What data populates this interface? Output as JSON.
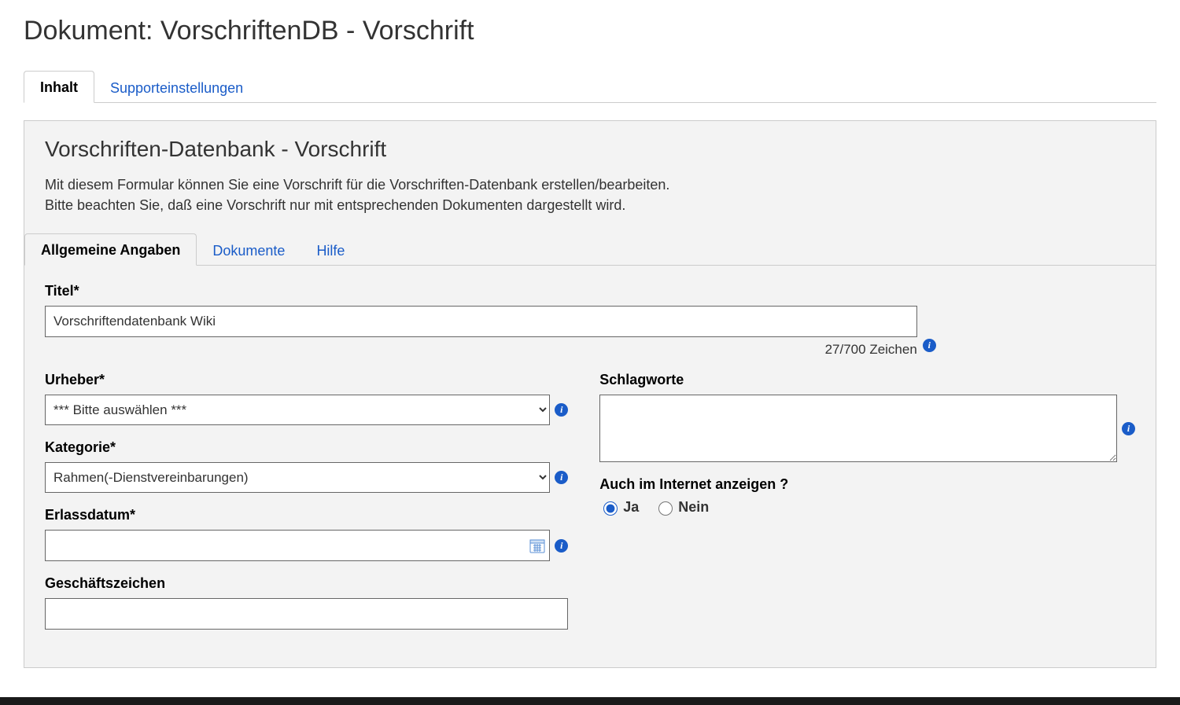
{
  "header": {
    "title": "Dokument: VorschriftenDB - Vorschrift"
  },
  "tabs": {
    "inhalt": "Inhalt",
    "support": "Supporteinstellungen"
  },
  "panel": {
    "title": "Vorschriften-Datenbank - Vorschrift",
    "desc_line1": "Mit diesem Formular können Sie eine Vorschrift für die Vorschriften-Datenbank erstellen/bearbeiten.",
    "desc_line2": "Bitte beachten Sie, daß eine Vorschrift nur mit entsprechenden Dokumenten dargestellt wird."
  },
  "inner_tabs": {
    "allgemein": "Allgemeine Angaben",
    "dokumente": "Dokumente",
    "hilfe": "Hilfe"
  },
  "form": {
    "titel_label": "Titel*",
    "titel_value": "Vorschriftendatenbank Wiki",
    "titel_counter": "27/700 Zeichen",
    "urheber_label": "Urheber*",
    "urheber_value": "*** Bitte auswählen ***",
    "kategorie_label": "Kategorie*",
    "kategorie_value": "Rahmen(-Dienstvereinbarungen)",
    "erlassdatum_label": "Erlassdatum*",
    "erlassdatum_value": "",
    "geschaeftszeichen_label": "Geschäftszeichen",
    "geschaeftszeichen_value": "",
    "schlagworte_label": "Schlagworte",
    "schlagworte_value": "",
    "internet_label": "Auch im Internet anzeigen ?",
    "internet_ja": "Ja",
    "internet_nein": "Nein",
    "internet_selected": "ja"
  }
}
